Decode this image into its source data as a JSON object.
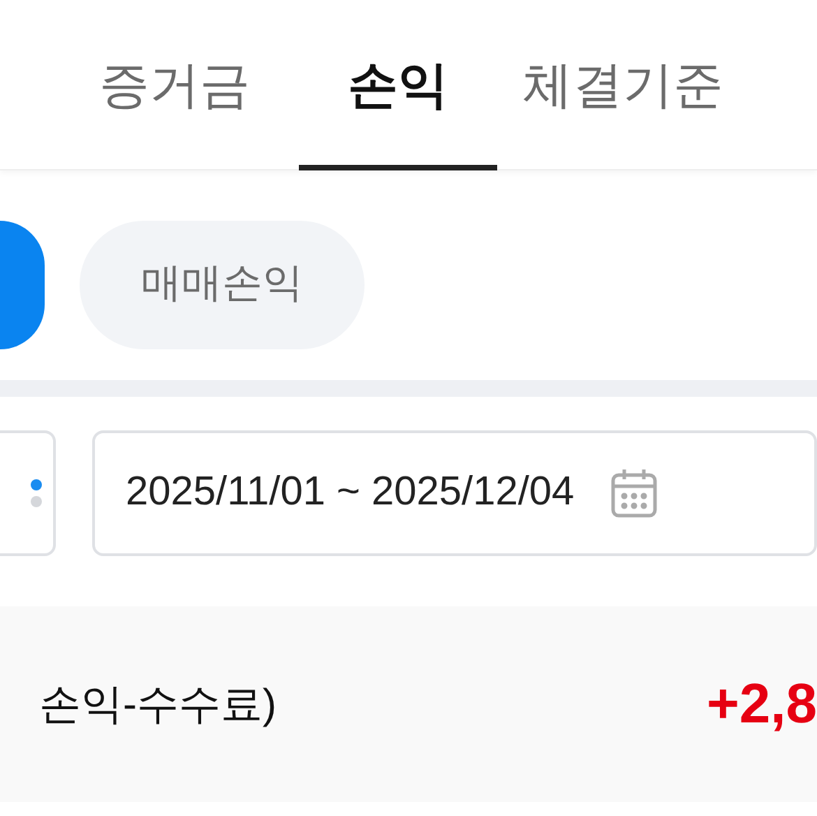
{
  "tabs": [
    {
      "label": "증거금",
      "selected": false
    },
    {
      "label": "손익",
      "selected": true
    },
    {
      "label": "체결기준",
      "selected": false
    }
  ],
  "chips": [
    {
      "selected": true
    },
    {
      "label": "매매손익",
      "selected": false
    }
  ],
  "date_range": {
    "value": "2025/11/01 ~ 2025/12/04"
  },
  "summary": {
    "label": "손익-수수료)",
    "value": "+2,8"
  }
}
